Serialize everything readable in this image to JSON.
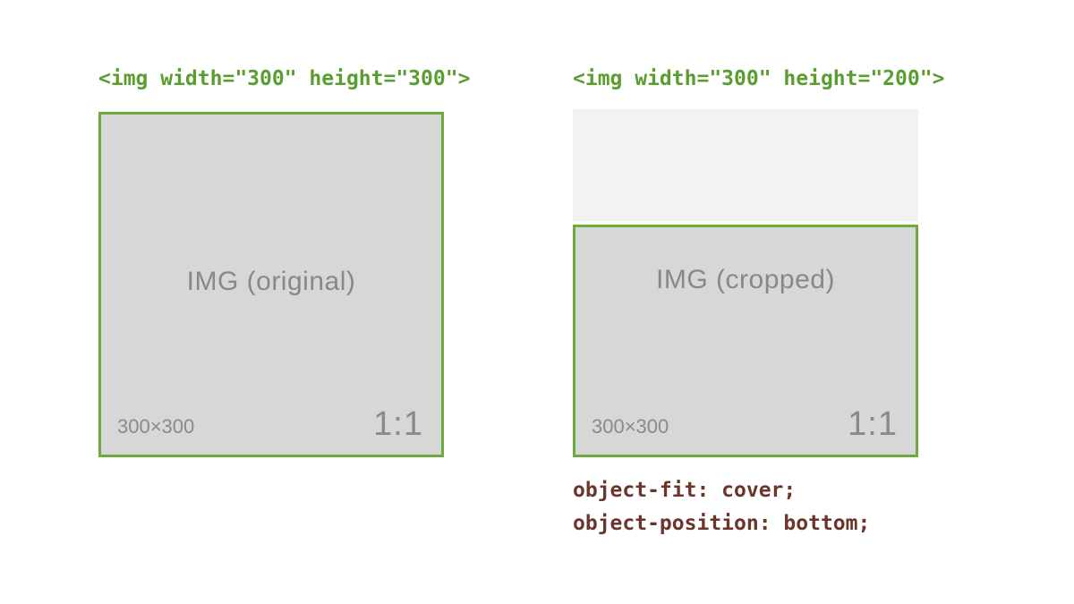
{
  "left": {
    "tag": "<img width=\"300\" height=\"300\">",
    "placeholder_label": "IMG (original)",
    "dim_text": "300×300",
    "ratio_text": "1:1"
  },
  "right": {
    "tag": "<img width=\"300\" height=\"200\">",
    "placeholder_label": "IMG (cropped)",
    "dim_text": "300×300",
    "ratio_text": "1:1",
    "css_line_1": "object-fit: cover;",
    "css_line_2": "object-position: bottom;"
  }
}
